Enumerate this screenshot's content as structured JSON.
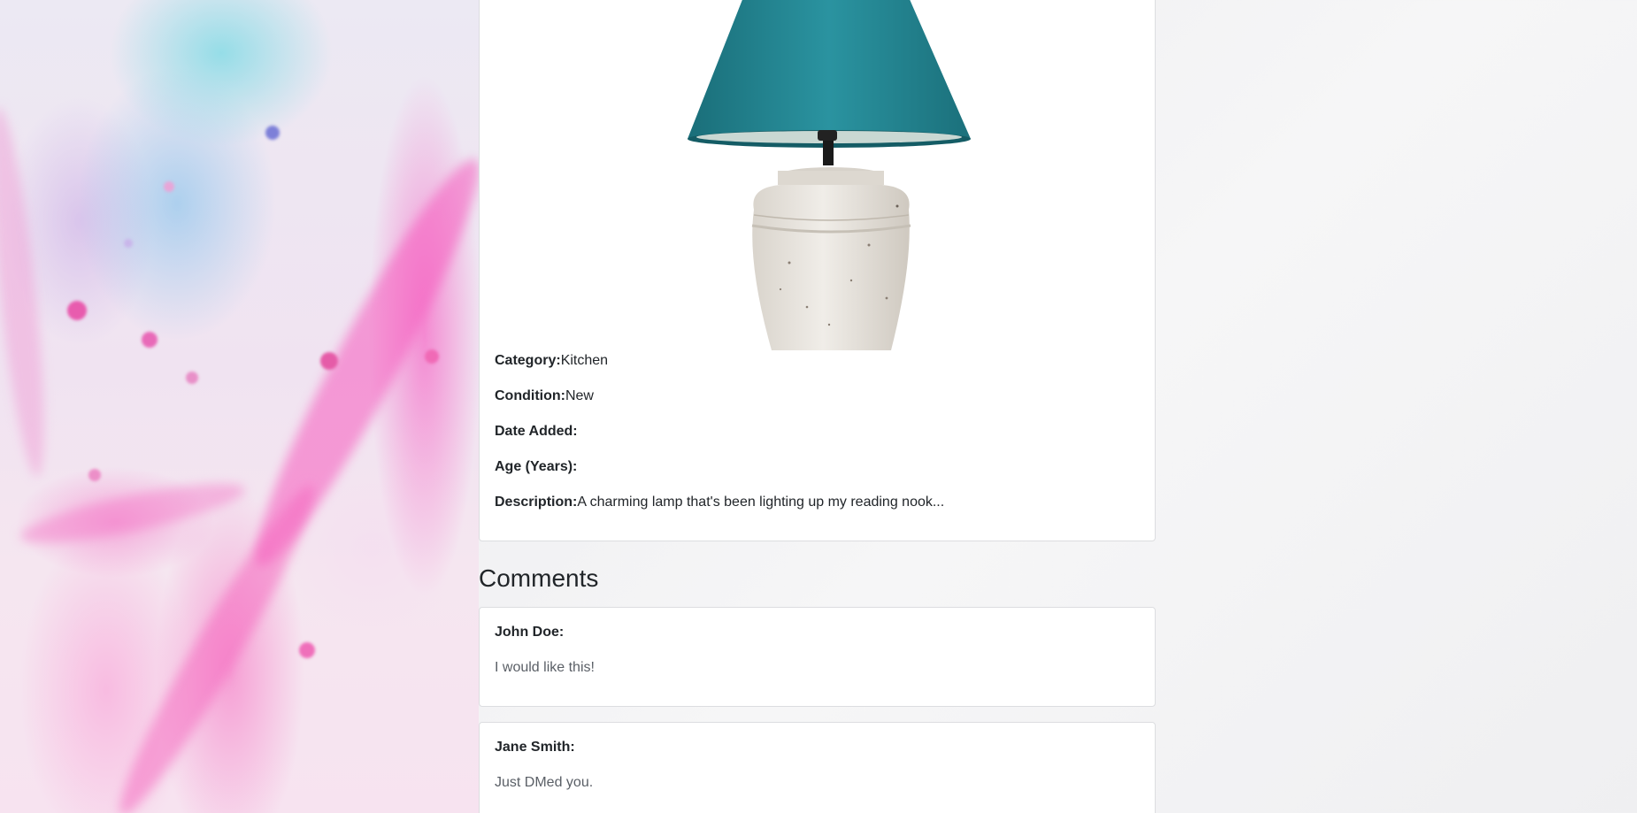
{
  "product": {
    "image_alt": "Teal table lamp with stone base",
    "details": [
      {
        "label": "Category:",
        "value": "Kitchen"
      },
      {
        "label": "Condition:",
        "value": "New"
      },
      {
        "label": "Date Added:",
        "value": ""
      },
      {
        "label": "Age (Years):",
        "value": ""
      },
      {
        "label": "Description:",
        "value": "A charming lamp that's been lighting up my reading nook..."
      }
    ]
  },
  "comments": {
    "title": "Comments",
    "items": [
      {
        "author": "John Doe:",
        "text": "I would like this!"
      },
      {
        "author": "Jane Smith:",
        "text": "Just DMed you."
      }
    ]
  },
  "colors": {
    "lampshade": "#1f7f8c",
    "lamp_base": "#e6e2dc",
    "card_border": "#dcdde0"
  }
}
